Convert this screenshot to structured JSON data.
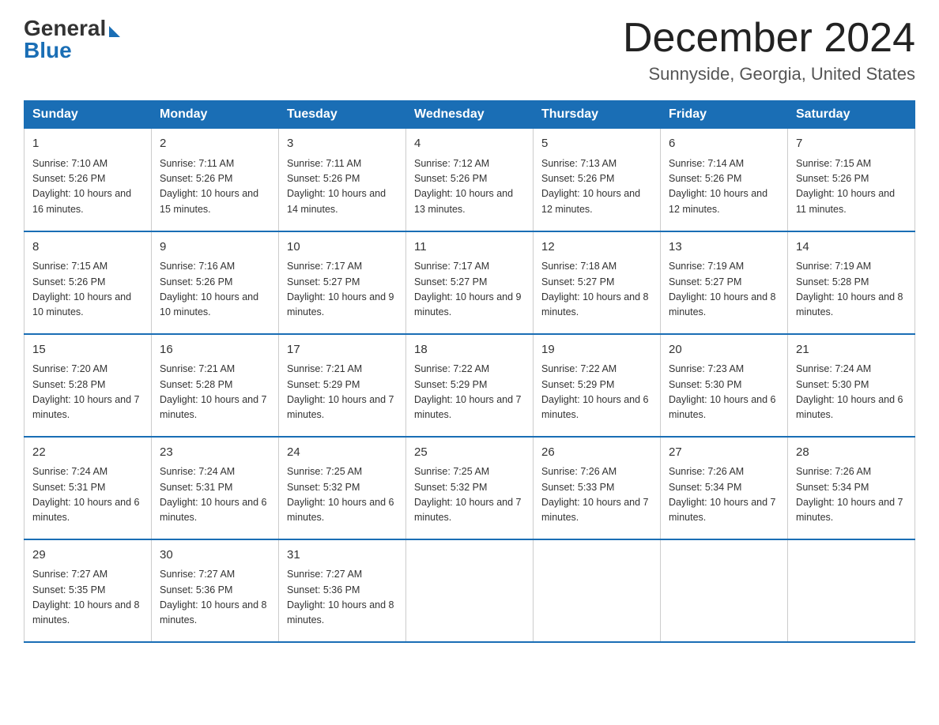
{
  "logo": {
    "general": "General",
    "blue": "Blue"
  },
  "title": "December 2024",
  "subtitle": "Sunnyside, Georgia, United States",
  "headers": [
    "Sunday",
    "Monday",
    "Tuesday",
    "Wednesday",
    "Thursday",
    "Friday",
    "Saturday"
  ],
  "weeks": [
    [
      {
        "day": "1",
        "sunrise": "7:10 AM",
        "sunset": "5:26 PM",
        "daylight": "10 hours and 16 minutes."
      },
      {
        "day": "2",
        "sunrise": "7:11 AM",
        "sunset": "5:26 PM",
        "daylight": "10 hours and 15 minutes."
      },
      {
        "day": "3",
        "sunrise": "7:11 AM",
        "sunset": "5:26 PM",
        "daylight": "10 hours and 14 minutes."
      },
      {
        "day": "4",
        "sunrise": "7:12 AM",
        "sunset": "5:26 PM",
        "daylight": "10 hours and 13 minutes."
      },
      {
        "day": "5",
        "sunrise": "7:13 AM",
        "sunset": "5:26 PM",
        "daylight": "10 hours and 12 minutes."
      },
      {
        "day": "6",
        "sunrise": "7:14 AM",
        "sunset": "5:26 PM",
        "daylight": "10 hours and 12 minutes."
      },
      {
        "day": "7",
        "sunrise": "7:15 AM",
        "sunset": "5:26 PM",
        "daylight": "10 hours and 11 minutes."
      }
    ],
    [
      {
        "day": "8",
        "sunrise": "7:15 AM",
        "sunset": "5:26 PM",
        "daylight": "10 hours and 10 minutes."
      },
      {
        "day": "9",
        "sunrise": "7:16 AM",
        "sunset": "5:26 PM",
        "daylight": "10 hours and 10 minutes."
      },
      {
        "day": "10",
        "sunrise": "7:17 AM",
        "sunset": "5:27 PM",
        "daylight": "10 hours and 9 minutes."
      },
      {
        "day": "11",
        "sunrise": "7:17 AM",
        "sunset": "5:27 PM",
        "daylight": "10 hours and 9 minutes."
      },
      {
        "day": "12",
        "sunrise": "7:18 AM",
        "sunset": "5:27 PM",
        "daylight": "10 hours and 8 minutes."
      },
      {
        "day": "13",
        "sunrise": "7:19 AM",
        "sunset": "5:27 PM",
        "daylight": "10 hours and 8 minutes."
      },
      {
        "day": "14",
        "sunrise": "7:19 AM",
        "sunset": "5:28 PM",
        "daylight": "10 hours and 8 minutes."
      }
    ],
    [
      {
        "day": "15",
        "sunrise": "7:20 AM",
        "sunset": "5:28 PM",
        "daylight": "10 hours and 7 minutes."
      },
      {
        "day": "16",
        "sunrise": "7:21 AM",
        "sunset": "5:28 PM",
        "daylight": "10 hours and 7 minutes."
      },
      {
        "day": "17",
        "sunrise": "7:21 AM",
        "sunset": "5:29 PM",
        "daylight": "10 hours and 7 minutes."
      },
      {
        "day": "18",
        "sunrise": "7:22 AM",
        "sunset": "5:29 PM",
        "daylight": "10 hours and 7 minutes."
      },
      {
        "day": "19",
        "sunrise": "7:22 AM",
        "sunset": "5:29 PM",
        "daylight": "10 hours and 6 minutes."
      },
      {
        "day": "20",
        "sunrise": "7:23 AM",
        "sunset": "5:30 PM",
        "daylight": "10 hours and 6 minutes."
      },
      {
        "day": "21",
        "sunrise": "7:24 AM",
        "sunset": "5:30 PM",
        "daylight": "10 hours and 6 minutes."
      }
    ],
    [
      {
        "day": "22",
        "sunrise": "7:24 AM",
        "sunset": "5:31 PM",
        "daylight": "10 hours and 6 minutes."
      },
      {
        "day": "23",
        "sunrise": "7:24 AM",
        "sunset": "5:31 PM",
        "daylight": "10 hours and 6 minutes."
      },
      {
        "day": "24",
        "sunrise": "7:25 AM",
        "sunset": "5:32 PM",
        "daylight": "10 hours and 6 minutes."
      },
      {
        "day": "25",
        "sunrise": "7:25 AM",
        "sunset": "5:32 PM",
        "daylight": "10 hours and 7 minutes."
      },
      {
        "day": "26",
        "sunrise": "7:26 AM",
        "sunset": "5:33 PM",
        "daylight": "10 hours and 7 minutes."
      },
      {
        "day": "27",
        "sunrise": "7:26 AM",
        "sunset": "5:34 PM",
        "daylight": "10 hours and 7 minutes."
      },
      {
        "day": "28",
        "sunrise": "7:26 AM",
        "sunset": "5:34 PM",
        "daylight": "10 hours and 7 minutes."
      }
    ],
    [
      {
        "day": "29",
        "sunrise": "7:27 AM",
        "sunset": "5:35 PM",
        "daylight": "10 hours and 8 minutes."
      },
      {
        "day": "30",
        "sunrise": "7:27 AM",
        "sunset": "5:36 PM",
        "daylight": "10 hours and 8 minutes."
      },
      {
        "day": "31",
        "sunrise": "7:27 AM",
        "sunset": "5:36 PM",
        "daylight": "10 hours and 8 minutes."
      },
      null,
      null,
      null,
      null
    ]
  ]
}
